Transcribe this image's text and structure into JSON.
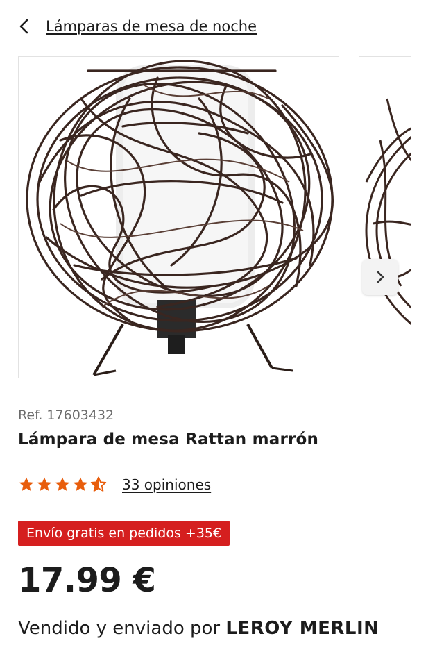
{
  "breadcrumb": {
    "label": "Lámparas de mesa de noche"
  },
  "product": {
    "ref": "Ref. 17603432",
    "title": "Lámpara de mesa Rattan marrón",
    "rating": {
      "value": 4.5,
      "max": 5,
      "reviews_label": "33 opiniones"
    },
    "shipping_badge": "Envío gratis en pedidos +35€",
    "price": "17.99 €",
    "seller_prefix": "Vendido y enviado por",
    "seller_name": "LEROY MERLIN"
  },
  "colors": {
    "accent_star": "#e85d0c",
    "badge_red": "#d51f1f",
    "text": "#1c1c1c"
  },
  "icons": {
    "back": "chevron-left-icon",
    "next": "chevron-right-icon",
    "star": "star-icon"
  }
}
